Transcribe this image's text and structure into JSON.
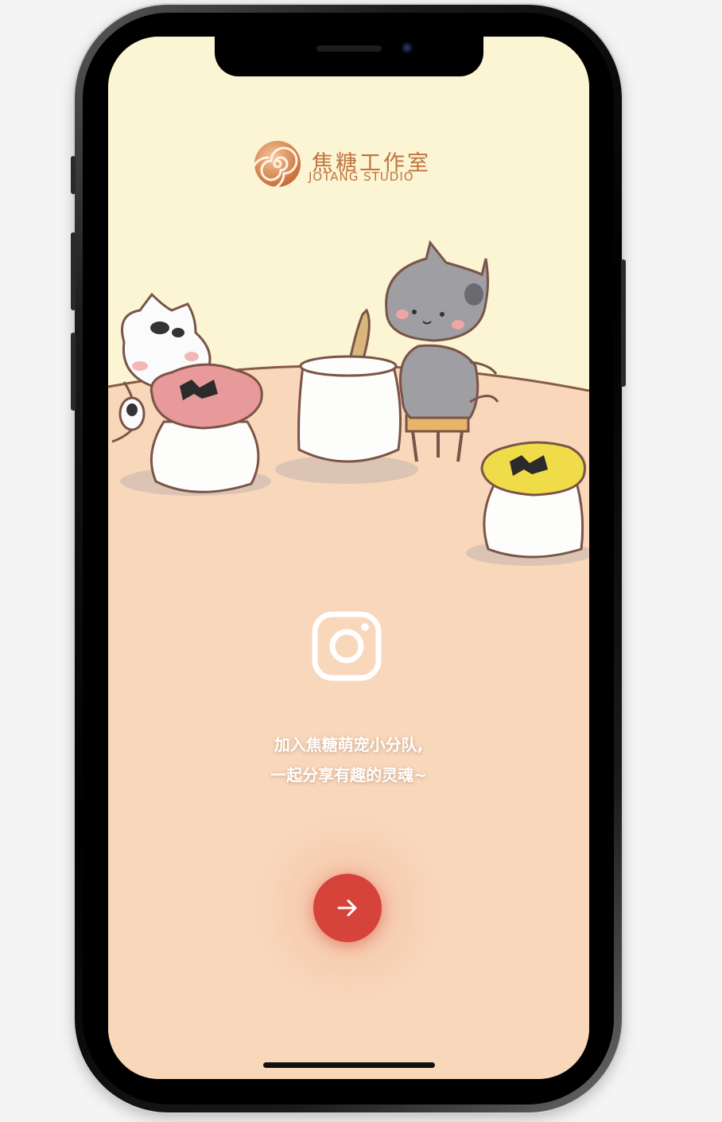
{
  "logo": {
    "title": "焦糖工作室",
    "subtitle": "JOTANG STUDIO"
  },
  "tagline": {
    "line1": "加入焦糖萌宠小分队,",
    "line2": "一起分享有趣的灵魂~"
  },
  "icons": {
    "social": "instagram-icon",
    "next": "arrow-right-icon"
  },
  "colors": {
    "wall": "#fbf5d3",
    "floor": "#f8d7bb",
    "accent": "#d6433a",
    "brand": "#c0743f"
  }
}
